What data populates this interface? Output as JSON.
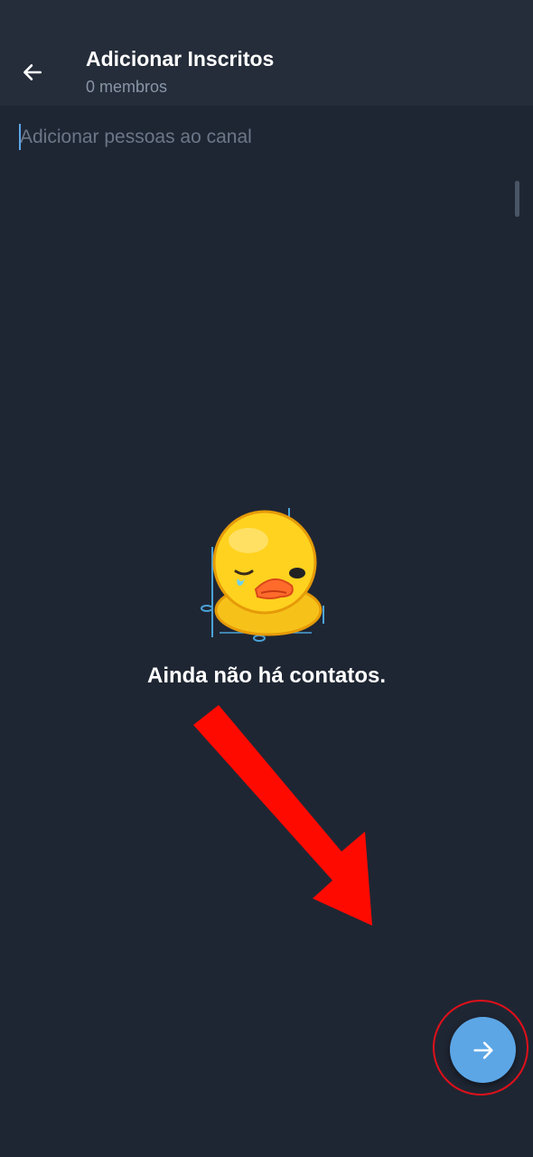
{
  "header": {
    "title": "Adicionar Inscritos",
    "subtitle": "0 membros",
    "back_icon": "arrow-left-icon"
  },
  "search": {
    "placeholder": "Adicionar pessoas ao canal",
    "value": ""
  },
  "empty_state": {
    "message": "Ainda não há contatos.",
    "illustration": "sad-duck-sticker"
  },
  "fab": {
    "icon": "arrow-right-icon",
    "color": "#5ca6e6"
  },
  "annotation": {
    "arrow_color": "#ff0a00",
    "circle_color": "#e0101a"
  },
  "colors": {
    "background": "#1f2633",
    "header": "#252d3a",
    "accent": "#5ca6e6"
  }
}
